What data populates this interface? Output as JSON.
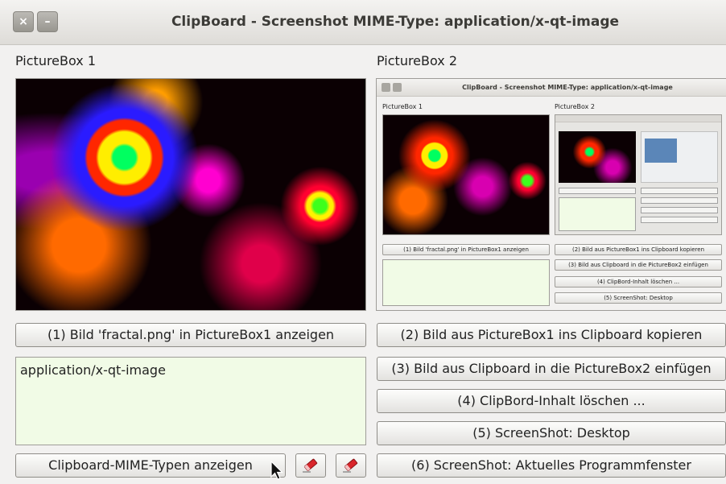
{
  "window": {
    "title": "ClipBoard - Screenshot MIME-Type: application/x-qt-image",
    "close_glyph": "×",
    "minimize_glyph": "–"
  },
  "left": {
    "label": "PictureBox 1",
    "button1": "(1) Bild 'fractal.png' in PictureBox1 anzeigen",
    "mime_text": "application/x-qt-image",
    "show_mime_button": "Clipboard-MIME-Typen anzeigen"
  },
  "right": {
    "label": "PictureBox 2",
    "button2": "(2) Bild aus PictureBox1 ins Clipboard kopieren",
    "button3": "(3) Bild aus Clipboard in die PictureBox2 einfügen",
    "button4": "(4) ClipBord-Inhalt löschen ...",
    "button5": "(5) ScreenShot: Desktop",
    "button6": "(6) ScreenShot: Aktuelles Programmfenster"
  },
  "thumbnail": {
    "title": "ClipBoard - Screenshot MIME-Type: application/x-qt-image",
    "label1": "PictureBox 1",
    "label2": "PictureBox 2",
    "button1": "(1) Bild 'fractal.png' in PictureBox1 anzeigen",
    "button2": "(2) Bild aus PictureBox1 ins Clipboard kopieren",
    "button3": "(3) Bild aus Clipboard in die PictureBox2 einfügen",
    "button4": "(4) ClipBord-Inhalt löschen ...",
    "button5": "(5) ScreenShot: Desktop"
  },
  "colors": {
    "textarea_bg": "#f1fbe6",
    "eraser_icon": "#d9262b"
  },
  "icons": {
    "eraser1": "eraser-icon",
    "eraser2": "eraser-icon",
    "cursor": "mouse-cursor-icon"
  }
}
